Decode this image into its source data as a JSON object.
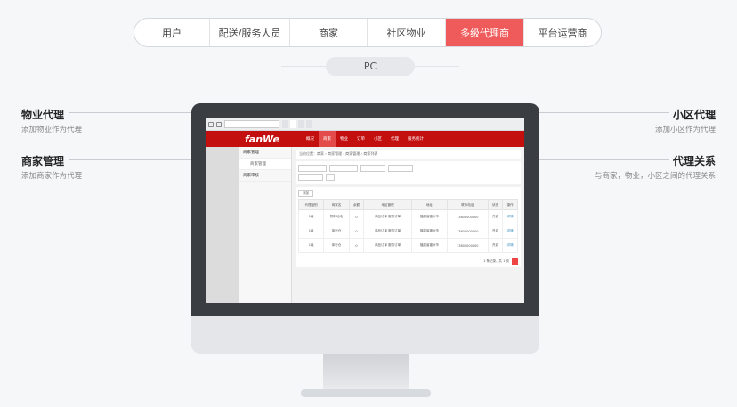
{
  "tabs": [
    {
      "label": "用户",
      "w": 85,
      "active": false
    },
    {
      "label": "配送/服务人员",
      "w": 90,
      "active": false
    },
    {
      "label": "商家",
      "w": 87,
      "active": false
    },
    {
      "label": "社区物业",
      "w": 88,
      "active": false
    },
    {
      "label": "多级代理商",
      "w": 88,
      "active": true
    },
    {
      "label": "平台运营商",
      "w": 86,
      "active": false
    }
  ],
  "pc_label": "PC",
  "callouts": {
    "property_agent": {
      "title": "物业代理",
      "desc": "添加物业作为代理"
    },
    "merchant_mgmt": {
      "title": "商家管理",
      "desc": "添加商家作为代理"
    },
    "community_agent": {
      "title": "小区代理",
      "desc": "添加小区作为代理"
    },
    "agent_relation": {
      "title": "代理关系",
      "desc": "与商家，物业，小区之间的代理关系"
    }
  },
  "screen": {
    "logo": "fanWe",
    "nav": [
      {
        "label": "概况",
        "on": false
      },
      {
        "label": "商家",
        "on": true
      },
      {
        "label": "物业",
        "on": false
      },
      {
        "label": "订单",
        "on": false
      },
      {
        "label": "小区",
        "on": false
      },
      {
        "label": "代理",
        "on": false
      },
      {
        "label": "服务统计",
        "on": false
      }
    ],
    "sidebar": [
      "商家管理",
      "商家管理",
      "商家审核"
    ],
    "breadcrumb": "当前位置：商家 › 商家管理 › 商家管理 › 商家列表",
    "add_btn": "添加",
    "table_headers": [
      "代理级别",
      "商家名",
      "余额",
      "地区管理",
      "地址",
      "联系电话",
      "状态",
      "操作"
    ],
    "rows": [
      [
        "1级",
        "物料地地",
        "0",
        "商品订单 服务订单",
        "福建省福州市",
        "13800000000",
        "开启",
        "详情"
      ],
      [
        "1级",
        "体行仓",
        "0",
        "商品订单 服务订单",
        "福建省福州市",
        "13800000000",
        "开启",
        "详情"
      ],
      [
        "1级",
        "体行仓",
        "0",
        "商品订单 服务订单",
        "福建省福州市",
        "13800000000",
        "开启",
        "详情"
      ]
    ],
    "pager": "1 条记录，共 1 页"
  }
}
